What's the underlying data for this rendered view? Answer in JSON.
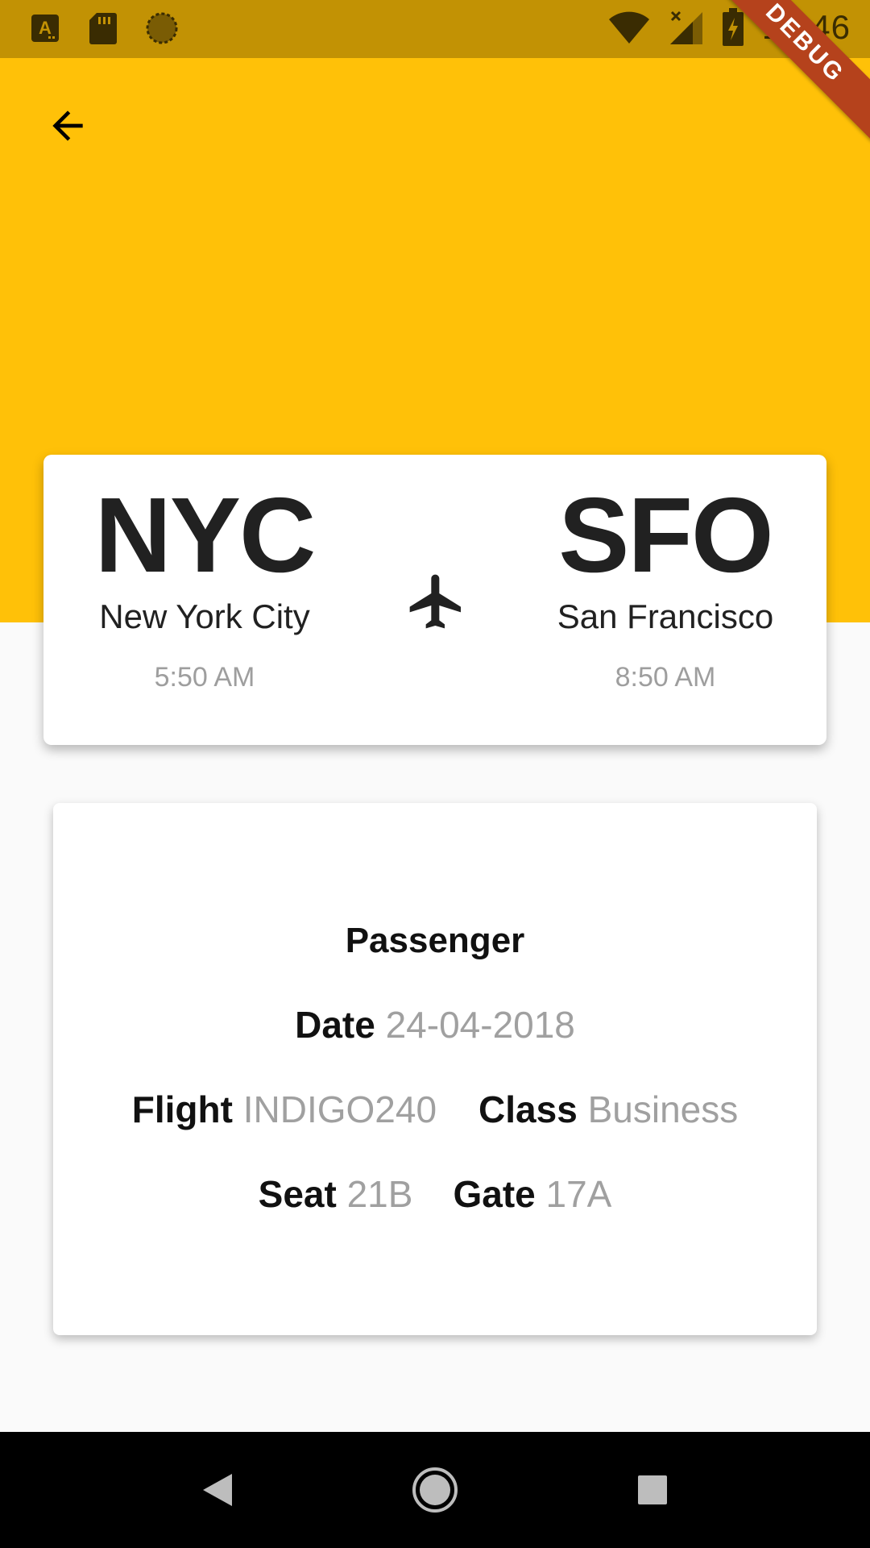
{
  "status_bar": {
    "time": "10:46"
  },
  "colors": {
    "header": "#FFC108",
    "status_bar": "#C29204",
    "debug_ribbon": "#B5421C"
  },
  "debug_ribbon": "DEBUG",
  "icons": {
    "back": "arrow-left-icon",
    "plane": "airplane-icon",
    "nav_back": "triangle-back-icon",
    "nav_home": "circle-home-icon",
    "nav_recents": "square-recents-icon"
  },
  "route": {
    "from": {
      "code": "NYC",
      "city": "New York City",
      "time": "5:50 AM"
    },
    "to": {
      "code": "SFO",
      "city": "San Francisco",
      "time": "8:50 AM"
    }
  },
  "details": {
    "title": "Passenger",
    "date_label": "Date",
    "date_value": "24-04-2018",
    "flight_label": "Flight",
    "flight_value": "INDIGO240",
    "class_label": "Class",
    "class_value": "Business",
    "seat_label": "Seat",
    "seat_value": "21B",
    "gate_label": "Gate",
    "gate_value": "17A"
  }
}
